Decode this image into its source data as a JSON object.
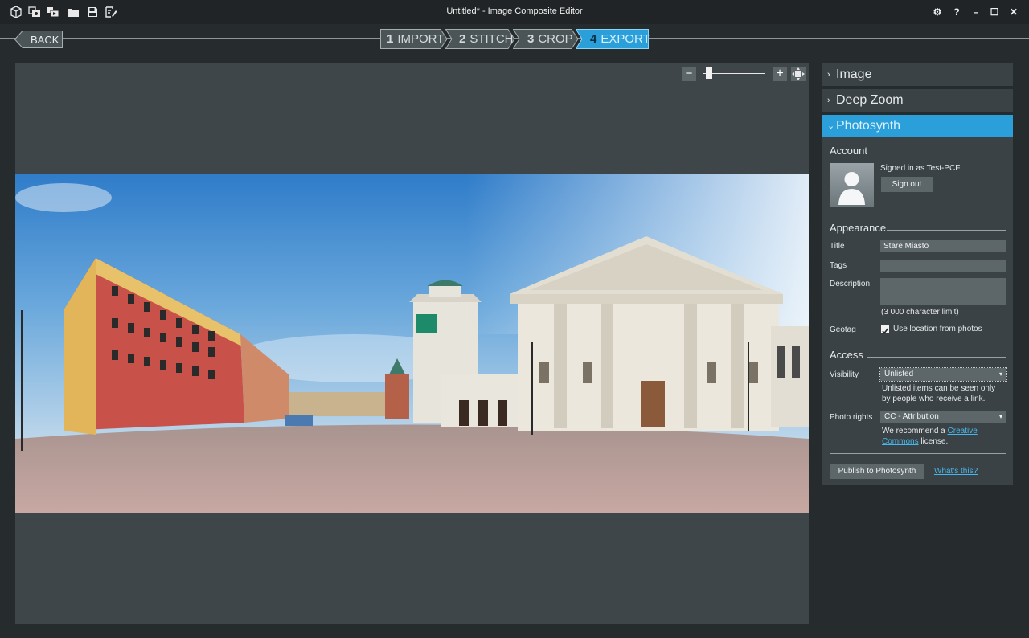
{
  "window": {
    "title": "Untitled* - Image Composite Editor",
    "controls": {
      "settings": "⚙",
      "help": "?",
      "minimize": "–",
      "maximize": "☐",
      "close": "✕"
    }
  },
  "toolbar_icons": [
    "new-project-icon",
    "new-panorama-icon",
    "new-video-icon",
    "open-folder-icon",
    "save-icon",
    "export-icon"
  ],
  "nav": {
    "back_label": "BACK",
    "steps": [
      {
        "num": "1",
        "label": "IMPORT",
        "active": false
      },
      {
        "num": "2",
        "label": "STITCH",
        "active": false
      },
      {
        "num": "3",
        "label": "CROP",
        "active": false
      },
      {
        "num": "4",
        "label": "EXPORT",
        "active": true
      }
    ]
  },
  "zoom": {
    "minus": "−",
    "plus": "+",
    "level": 0.05
  },
  "panel": {
    "sections": [
      {
        "label": "Image",
        "expanded": false
      },
      {
        "label": "Deep Zoom",
        "expanded": false
      },
      {
        "label": "Photosynth",
        "expanded": true
      }
    ],
    "account": {
      "title": "Account",
      "signed_in": "Signed in as Test-PCF",
      "sign_out": "Sign out"
    },
    "appearance": {
      "title": "Appearance",
      "title_label": "Title",
      "title_value": "Stare Miasto",
      "tags_label": "Tags",
      "tags_value": "",
      "description_label": "Description",
      "description_value": "",
      "char_limit": "(3 000 character limit)",
      "geotag_label": "Geotag",
      "geotag_option": "Use location from photos",
      "geotag_checked": true
    },
    "access": {
      "title": "Access",
      "visibility_label": "Visibility",
      "visibility_value": "Unlisted",
      "visibility_note_1": "Unlisted items can be seen only",
      "visibility_note_2": "by people who receive a link.",
      "rights_label": "Photo rights",
      "rights_value": "CC - Attribution",
      "recommend_pre": "We recommend a ",
      "recommend_link_1": "Creative",
      "recommend_link_2": "Commons",
      "recommend_post": " license."
    },
    "publish_label": "Publish to Photosynth",
    "whats_this": "What's this?"
  },
  "colors": {
    "accent": "#2a9fd9",
    "background": "#262b2d",
    "panel": "#3a4245",
    "link": "#46b7ec"
  }
}
